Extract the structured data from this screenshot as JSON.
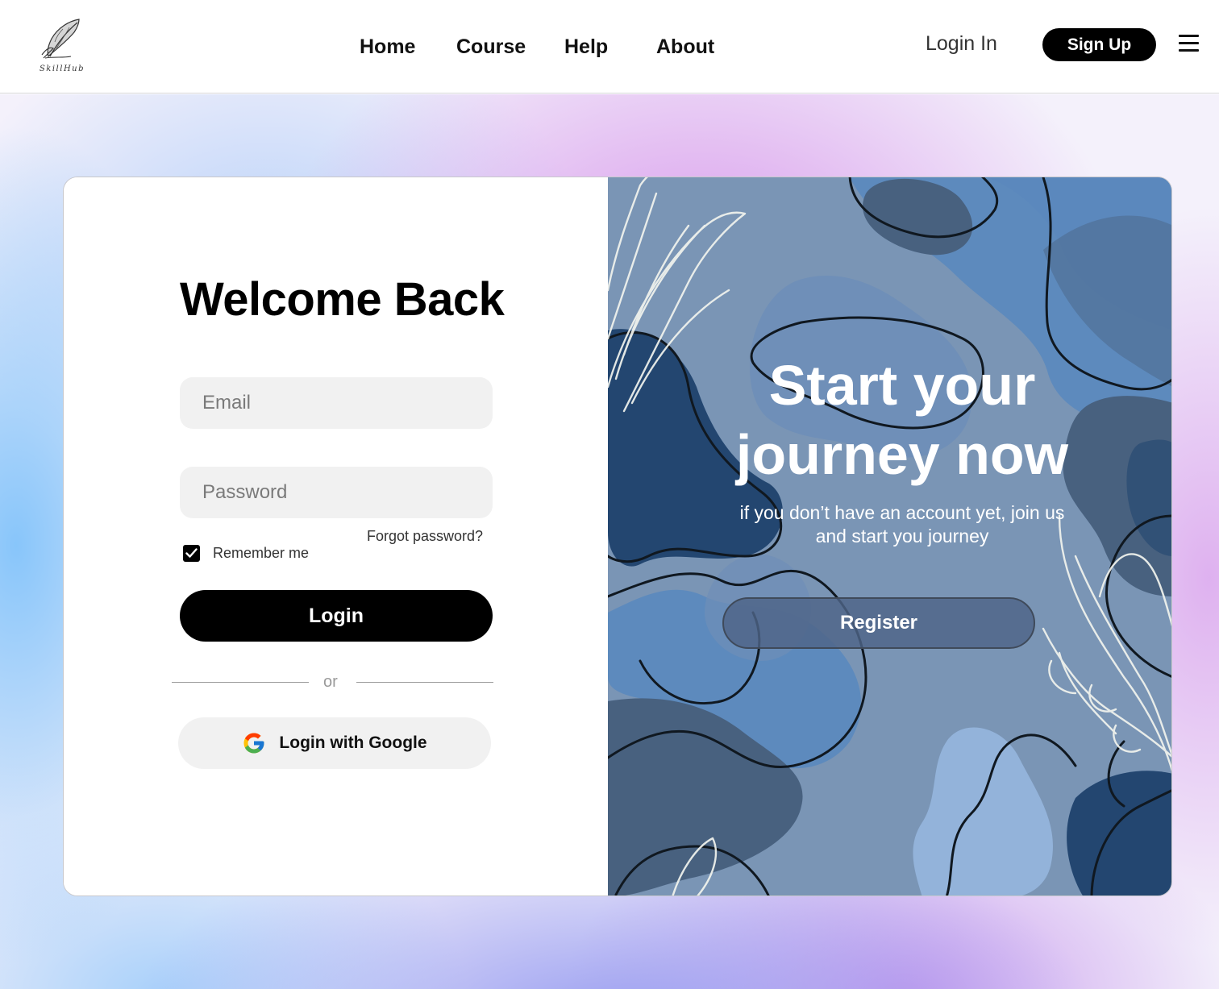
{
  "header": {
    "logo_text": "SkillHub",
    "nav": [
      {
        "label": "Home"
      },
      {
        "label": "Course"
      },
      {
        "label": "Help"
      },
      {
        "label": "About"
      }
    ],
    "login_label": "Login In",
    "signup_label": "Sign Up",
    "menu_icon": "hamburger-menu-icon"
  },
  "login_form": {
    "title": "Welcome Back",
    "email_placeholder": "Email",
    "password_placeholder": "Password",
    "forgot_label": "Forgot password?",
    "remember_label": "Remember me",
    "remember_checked": true,
    "login_button": "Login",
    "divider_text": "or",
    "google_button": "Login with Google",
    "google_icon": "google-g-icon"
  },
  "promo": {
    "headline_line1": "Start your",
    "headline_line2": "journey now",
    "subtext_line1": "if you don’t have an account yet, join us",
    "subtext_line2": "and start you journey",
    "register_button": "Register"
  },
  "colors": {
    "primary_button": "#000000",
    "input_bg": "#f1f1f1",
    "promo_bg": "#7a95b5",
    "promo_dark_blob": "#234670",
    "promo_slate_blob": "#48617f",
    "promo_light_blob": "#93b3da"
  }
}
